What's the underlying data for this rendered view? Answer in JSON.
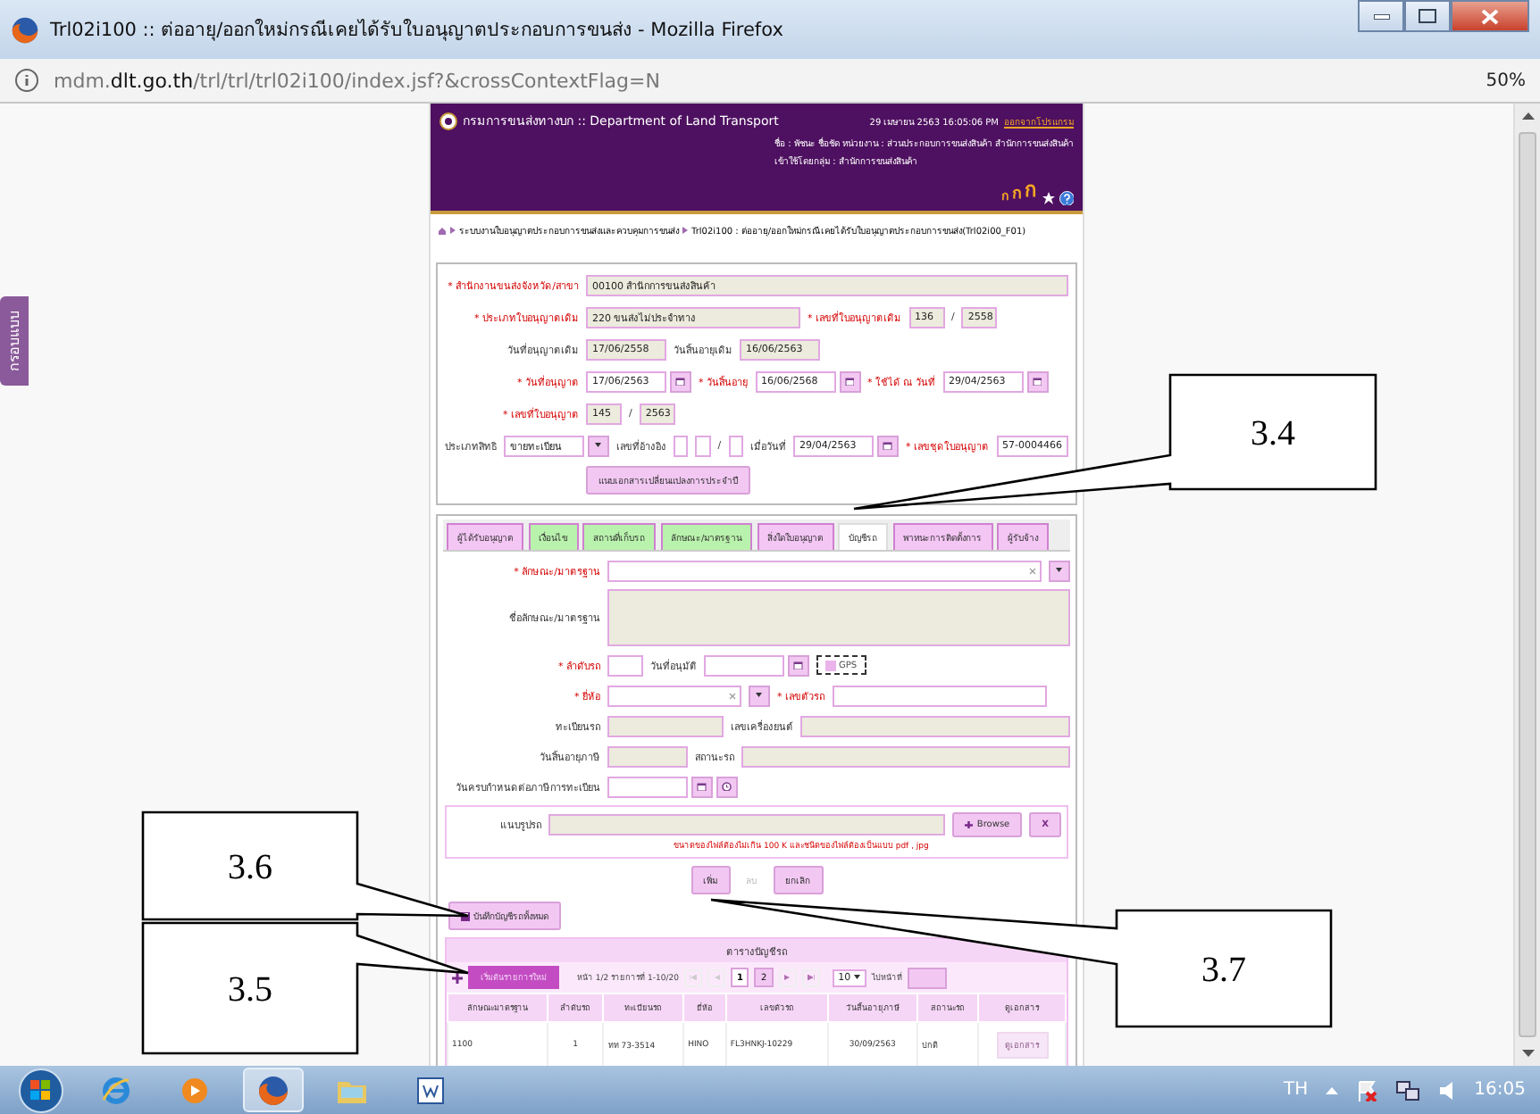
{
  "window": {
    "title": "Trl02i100 :: ต่ออายุ/ออกใหม่กรณีเคยได้รับใบอนุญาตประกอบการขนส่ง - Mozilla Firefox"
  },
  "address_bar": {
    "url": "mdm.**dlt.go.th**/trl/trl/trl02i100/index.jsf?&crossContextFlag=N",
    "zoom": "50%"
  },
  "side_tab": "กรอบแบบ",
  "header": {
    "org": "กรมการขนส่งทางบก :: Department of Land Transport",
    "datetime": "29 เมษายน 2563 16:05:06 PM",
    "logout": "ออกจากโปรแกรม",
    "user_line": "ชื่อ : พัชนะ ชื่อชัด    หน่วยงาน : ส่วนประกอบการขนส่งสินค้า สำนักการขนส่งสินค้า",
    "group_line": "เข้าใช้โดยกลุ่ม : สำนักการขนส่งสินค้า",
    "font_sizes": [
      "ก",
      "ก",
      "ก"
    ]
  },
  "breadcrumb": [
    "ระบบงานใบอนุญาตประกอบการขนส่งและควบคุมการขนส่ง",
    "Trl02i100 : ต่ออายุ/ออกใหม่กรณีเคยได้รับใบอนุญาตประกอบการขนส่ง(Trl02i00_F01)"
  ],
  "license_form": {
    "rows": [
      {
        "items": [
          {
            "kind": "label",
            "text": "* สำนักงานขนส่งจังหวัด/สาขา",
            "required": true
          },
          {
            "kind": "fullfield",
            "value": "00100 สำนักการขนส่งสินค้า",
            "readonly": true
          }
        ]
      },
      {
        "items": [
          {
            "kind": "label",
            "text": "* ประเภทใบอนุญาตเดิม",
            "required": true
          },
          {
            "kind": "widefield",
            "value": "220 ขนส่งไม่ประจำทาง",
            "readonly": true
          },
          {
            "kind": "label",
            "text": "* เลขที่ใบอนุญาตเดิม",
            "required": true
          },
          {
            "kind": "box",
            "value": "136",
            "readonly": true
          },
          {
            "kind": "sep",
            "text": "/"
          },
          {
            "kind": "box",
            "value": "2558",
            "readonly": true
          }
        ]
      },
      {
        "items": [
          {
            "kind": "label",
            "text": "วันที่อนุญาตเดิม",
            "required": false
          },
          {
            "kind": "field",
            "value": "17/06/2558",
            "readonly": true
          },
          {
            "kind": "label",
            "text": "วันสิ้นอายุเดิม",
            "required": false
          },
          {
            "kind": "field",
            "value": "16/06/2563",
            "readonly": true
          }
        ]
      },
      {
        "items": [
          {
            "kind": "label",
            "text": "* วันที่อนุญาต",
            "required": true
          },
          {
            "kind": "date",
            "value": "17/06/2563",
            "readonly": false
          },
          {
            "kind": "label",
            "text": "* วันสิ้นอายุ",
            "required": true
          },
          {
            "kind": "date",
            "value": "16/06/2568",
            "readonly": false
          },
          {
            "kind": "label",
            "text": "* ใช้ได้ ณ วันที่",
            "required": true
          },
          {
            "kind": "date",
            "value": "29/04/2563",
            "readonly": false
          }
        ]
      },
      {
        "items": [
          {
            "kind": "label",
            "text": "* เลขที่ใบอนุญาต",
            "required": true
          },
          {
            "kind": "box",
            "value": "145",
            "readonly": true
          },
          {
            "kind": "sep",
            "text": "/"
          },
          {
            "kind": "box",
            "value": "2563",
            "readonly": true
          }
        ]
      },
      {
        "items": [
          {
            "kind": "label",
            "text": "ประเภทสิทธิ",
            "required": false
          },
          {
            "kind": "select",
            "value": "ขายทะเบียน"
          },
          {
            "kind": "label",
            "text": "เลขที่อ้างอิง",
            "required": false
          },
          {
            "kind": "box",
            "readonly": false
          },
          {
            "kind": "box",
            "readonly": false
          },
          {
            "kind": "sep",
            "text": "/"
          },
          {
            "kind": "box",
            "readonly": false
          },
          {
            "kind": "label",
            "text": "เมื่อวันที่",
            "required": false
          },
          {
            "kind": "date",
            "value": "29/04/2563",
            "readonly": false
          },
          {
            "kind": "label",
            "text": "* เลขชุดใบอนุญาต",
            "required": true
          },
          {
            "kind": "field",
            "value": "57-0004466",
            "readonly": false
          }
        ]
      },
      {
        "items": [
          {
            "kind": "button",
            "text": "แนบเอกสารเปลี่ยนแปลงการประจำปี"
          }
        ]
      }
    ]
  },
  "tabs": [
    {
      "label": "ผู้ได้รับอนุญาต",
      "selected": false,
      "color": "#f4c6f4"
    },
    {
      "label": "เงื่อนไข",
      "selected": false,
      "color": "#b9f2ac"
    },
    {
      "label": "สถานที่เก็บรถ",
      "selected": false,
      "color": "#b9f2ac"
    },
    {
      "label": "ลักษณะ/มาตรฐาน",
      "selected": false,
      "color": "#b9f2ac"
    },
    {
      "label": "สิ่งใดใบอนุญาต",
      "selected": false,
      "color": "#f4c6f4"
    },
    {
      "label": "บัญชีรถ",
      "selected": true,
      "color": "#ffffff"
    },
    {
      "label": "พาหนะการติดตั้งการ",
      "selected": false,
      "color": "#f4c6f4"
    },
    {
      "label": "ผู้รับจ้าง",
      "selected": false,
      "color": "#f4c6f4"
    }
  ],
  "vehicle_form": {
    "rows": [
      {
        "items": [
          {
            "kind": "label",
            "text": "* ลักษณะ/มาตรฐาน",
            "required": true
          },
          {
            "kind": "combo"
          }
        ]
      },
      {
        "items": [
          {
            "kind": "label",
            "text": "ชื่อลักษณะ/มาตรฐาน",
            "required": false
          },
          {
            "kind": "textarea",
            "readonly": true
          }
        ]
      },
      {
        "items": [
          {
            "kind": "label",
            "text": "* ลำดับรถ",
            "required": true
          },
          {
            "kind": "box",
            "readonly": false
          },
          {
            "kind": "label",
            "text": "วันที่อนุมัติ",
            "required": false
          },
          {
            "kind": "date",
            "readonly": false
          },
          {
            "kind": "checkbox",
            "text": "GPS",
            "checked": false
          }
        ]
      },
      {
        "items": [
          {
            "kind": "label",
            "text": "* ยี่ห้อ",
            "required": true
          },
          {
            "kind": "shortcombo"
          },
          {
            "kind": "label",
            "text": "* เลขตัวรถ",
            "required": true
          },
          {
            "kind": "widefield",
            "readonly": false
          }
        ]
      },
      {
        "items": [
          {
            "kind": "label",
            "text": "ทะเบียนรถ",
            "required": false
          },
          {
            "kind": "midfield",
            "readonly": true
          },
          {
            "kind": "label",
            "text": "เลขเครื่องยนต์",
            "required": false
          },
          {
            "kind": "fullfield",
            "readonly": true
          }
        ]
      },
      {
        "items": [
          {
            "kind": "label",
            "text": "วันสิ้นอายุภาษี",
            "required": false
          },
          {
            "kind": "field",
            "readonly": true
          },
          {
            "kind": "label",
            "text": "สถานะรถ",
            "required": false
          },
          {
            "kind": "fullfield",
            "readonly": true
          }
        ]
      },
      {
        "items": [
          {
            "kind": "label",
            "text": "วันครบกำหนดต่อภาษีการทะเบียน",
            "required": false
          },
          {
            "kind": "dateclock",
            "readonly": false
          }
        ]
      }
    ]
  },
  "attachment": {
    "label": "แนบรูปรถ",
    "browse": "Browse",
    "clear": "X",
    "note": "ขนาดของไฟล์ต้องไม่เกิน 100 K และชนิดของไฟล์ต้องเป็นแบบ pdf , jpg"
  },
  "actions": [
    {
      "label": "เพิ่ม",
      "disabled": false
    },
    {
      "label": "ลบ",
      "disabled": true
    },
    {
      "label": "ยกเลิก",
      "disabled": false
    }
  ],
  "save_all": "บันทึกบัญชีรถทั้งหมด",
  "vehicle_table": {
    "title": "ตารางบัญชีรถ",
    "new_list": "เริ่มต้นรายการใหม่",
    "page_info": "หน้า 1/2 รายการที่ 1-10/20",
    "pages": [
      {
        "label": "1",
        "selected": true
      },
      {
        "label": "2",
        "selected": false
      }
    ],
    "page_size": "10",
    "goto": "ไปหน้าที่",
    "columns": [
      "ลักษณะมาตรฐาน",
      "ลำดับรถ",
      "ทะเบียนรถ",
      "ยี่ห้อ",
      "เลขตัวรถ",
      "วันสิ้นอายุภาษี",
      "สถานะรถ",
      "ดูเอกสาร"
    ],
    "rows": [
      {
        "cells": [
          "1100",
          "1",
          "ทท 73-3514",
          "HINO",
          "FL3HNKJ-10229",
          "30/09/2563",
          "ปกติ"
        ],
        "document": "ดูเอกสาร"
      }
    ]
  },
  "callouts": [
    {
      "label": "3.4"
    },
    {
      "label": "3.6"
    },
    {
      "label": "3.5"
    },
    {
      "label": "3.7"
    }
  ],
  "taskbar": {
    "items": [
      {
        "kind": "ie",
        "selected": false
      },
      {
        "kind": "media",
        "selected": false
      },
      {
        "kind": "firefox",
        "selected": true
      },
      {
        "kind": "folder",
        "selected": false
      },
      {
        "kind": "word",
        "selected": false
      }
    ],
    "language": "TH",
    "clock": "16:05"
  }
}
